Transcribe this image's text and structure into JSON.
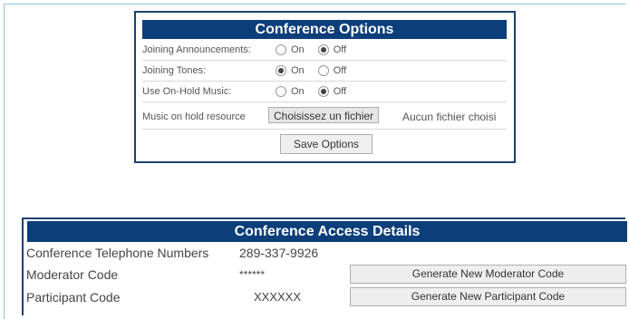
{
  "conference_options": {
    "title": "Conference Options",
    "rows": [
      {
        "label": "Joining Announcements:",
        "on_label": "On",
        "off_label": "Off",
        "selected": "off"
      },
      {
        "label": "Joining Tones:",
        "on_label": "On",
        "off_label": "Off",
        "selected": "on"
      },
      {
        "label": "Use On-Hold Music:",
        "on_label": "On",
        "off_label": "Off",
        "selected": "off"
      }
    ],
    "music_resource": {
      "label": "Music on hold resource",
      "button_label": "Choisissez un fichier",
      "no_file_text": "Aucun fichier choisi"
    },
    "save_label": "Save Options"
  },
  "access_details": {
    "title": "Conference Access Details",
    "telephone_label": "Conference Telephone Numbers",
    "telephone_value": "289-337-9926",
    "moderator_label": "Moderator Code",
    "moderator_value": "******",
    "moderator_button": "Generate New Moderator Code",
    "participant_label": "Participant Code",
    "participant_value": "XXXXXX",
    "participant_button": "Generate New Participant Code"
  }
}
